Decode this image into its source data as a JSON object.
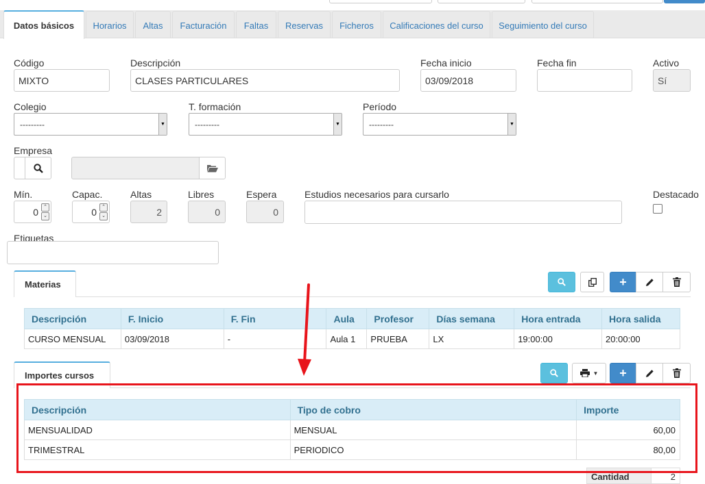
{
  "tabs": [
    "Datos básicos",
    "Horarios",
    "Altas",
    "Facturación",
    "Faltas",
    "Reservas",
    "Ficheros",
    "Calificaciones del curso",
    "Seguimiento del curso"
  ],
  "form": {
    "codigo_label": "Código",
    "codigo_value": "MIXTO",
    "descripcion_label": "Descripción",
    "descripcion_value": "CLASES PARTICULARES",
    "fecha_inicio_label": "Fecha inicio",
    "fecha_inicio_value": "03/09/2018",
    "fecha_fin_label": "Fecha fin",
    "fecha_fin_value": "",
    "activo_label": "Activo",
    "activo_value": "Sí",
    "colegio_label": "Colegio",
    "colegio_value": "---------",
    "formacion_label": "T. formación",
    "formacion_value": "---------",
    "periodo_label": "Período",
    "periodo_value": "---------",
    "empresa_label": "Empresa",
    "min_label": "Mín.",
    "min_value": "0",
    "capac_label": "Capac.",
    "capac_value": "0",
    "altas_label": "Altas",
    "altas_value": "2",
    "libres_label": "Libres",
    "libres_value": "0",
    "espera_label": "Espera",
    "espera_value": "0",
    "estudios_label": "Estudios necesarios para cursarlo",
    "destacado_label": "Destacado",
    "etiquetas_label": "Etiquetas"
  },
  "materias": {
    "tab_label": "Materias",
    "headers": [
      "Descripción",
      "F. Inicio",
      "F. Fin",
      "Aula",
      "Profesor",
      "Días semana",
      "Hora entrada",
      "Hora salida"
    ],
    "rows": [
      [
        "CURSO MENSUAL",
        "03/09/2018",
        "-",
        "Aula 1",
        "PRUEBA",
        "LX",
        "19:00:00",
        "20:00:00"
      ]
    ]
  },
  "importes": {
    "tab_label": "Importes cursos",
    "headers": [
      "Descripción",
      "Tipo de cobro",
      "Importe"
    ],
    "rows": [
      [
        "MENSUALIDAD",
        "MENSUAL",
        "60,00"
      ],
      [
        "TRIMESTRAL",
        "PERIODICO",
        "80,00"
      ]
    ],
    "cantidad_label": "Cantidad",
    "cantidad_value": "2"
  },
  "colors": {
    "accent": "#428bca",
    "info": "#5bc0de",
    "annotation": "#e8141b",
    "header_bg": "#d9edf7"
  }
}
